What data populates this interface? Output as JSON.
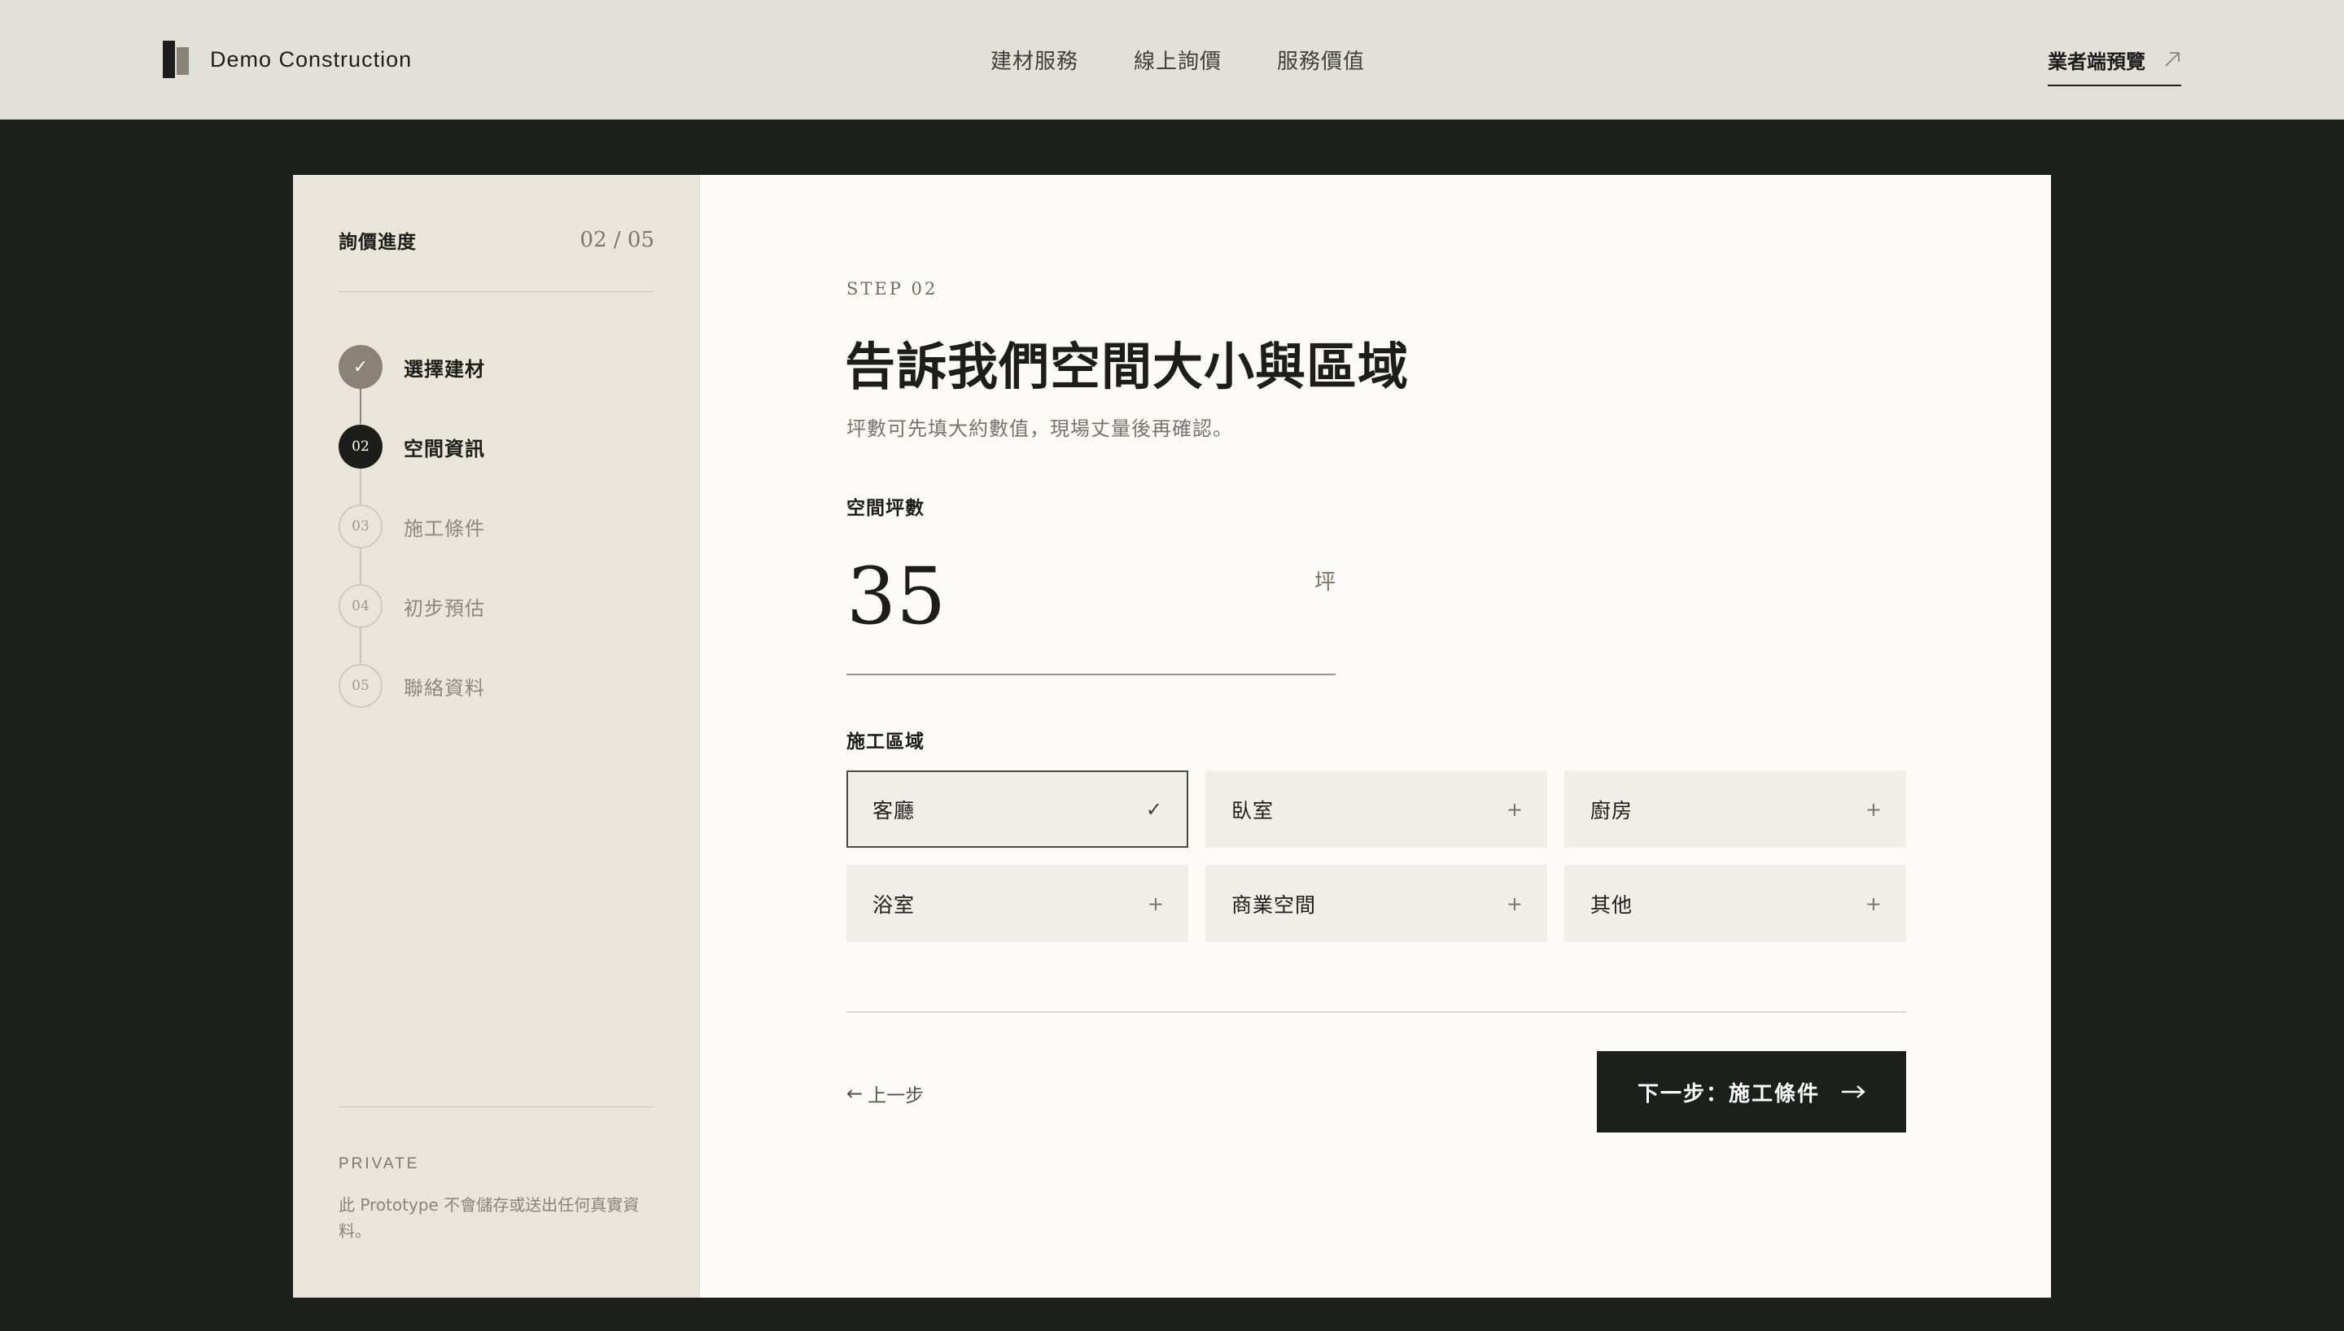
{
  "brand": {
    "name": "Demo Construction"
  },
  "nav": {
    "items": [
      {
        "label": "建材服務"
      },
      {
        "label": "線上詢價"
      },
      {
        "label": "服務價值"
      }
    ],
    "vendor_label": "業者端預覽",
    "vendor_icon": "external-arrow-icon"
  },
  "progress": {
    "title": "詢價進度",
    "count": "02 / 05",
    "steps": [
      {
        "num": "✓",
        "label": "選擇建材",
        "status": "done"
      },
      {
        "num": "02",
        "label": "空間資訊",
        "status": "current"
      },
      {
        "num": "03",
        "label": "施工條件",
        "status": "todo"
      },
      {
        "num": "04",
        "label": "初步預估",
        "status": "todo"
      },
      {
        "num": "05",
        "label": "聯絡資料",
        "status": "todo"
      }
    ]
  },
  "private": {
    "title": "PRIVATE",
    "note": "此 Prototype 不會儲存或送出任何真實資料。"
  },
  "form": {
    "kicker": "STEP 02",
    "heading": "告訴我們空間大小與區域",
    "subtitle": "坪數可先填大約數值，現場丈量後再確認。",
    "area_label": "空間坪數",
    "area_value": "35",
    "area_unit": "坪",
    "zones_label": "施工區域",
    "zones": [
      {
        "label": "客廳",
        "selected": true,
        "icon": "✓"
      },
      {
        "label": "臥室",
        "selected": false,
        "icon": "+"
      },
      {
        "label": "廚房",
        "selected": false,
        "icon": "+"
      },
      {
        "label": "浴室",
        "selected": false,
        "icon": "+"
      },
      {
        "label": "商業空間",
        "selected": false,
        "icon": "+"
      },
      {
        "label": "其他",
        "selected": false,
        "icon": "+"
      }
    ],
    "back_label": "上一步",
    "back_arrow": "←",
    "next_label": "下一步：施工條件"
  },
  "colors": {
    "header_bg": "#e2e1d9",
    "page_bg": "#1c201c",
    "sidebar_bg": "#e9e5da",
    "card_bg": "#fcfbf7",
    "accent_done": "#8a8274",
    "primary": "#1d1d1b"
  }
}
